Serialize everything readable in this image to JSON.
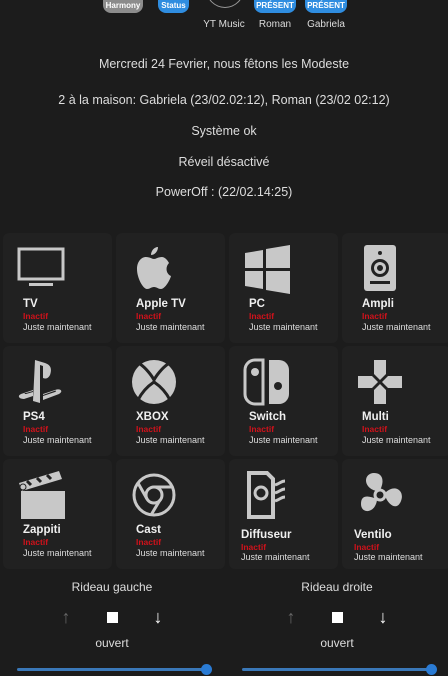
{
  "header": {
    "chips": [
      {
        "label": "Harmony",
        "color": "#8c8c8c"
      },
      {
        "label": "Status",
        "color": "#2f8de0"
      },
      {
        "label": "PRÉSENT",
        "color": "#2f8de0"
      },
      {
        "label": "PRÉSENT",
        "color": "#2f8de0"
      }
    ],
    "labels": [
      "YT Music",
      "Roman",
      "Gabriela"
    ]
  },
  "info": [
    "Mercredi 24 Fevrier, nous fêtons les Modeste",
    "2 à la maison: Gabriela (23/02.02:12), Roman (23/02 02:12)",
    "Système ok",
    "Réveil désactivé",
    "PowerOff : (22/02.14:25)"
  ],
  "devices": [
    {
      "name": "TV",
      "state": "Inactif",
      "time": "Juste maintenant",
      "icon": "tv-icon"
    },
    {
      "name": "Apple TV",
      "state": "Inactif",
      "time": "Juste maintenant",
      "icon": "apple-icon"
    },
    {
      "name": "PC",
      "state": "Inactif",
      "time": "Juste maintenant",
      "icon": "windows-icon"
    },
    {
      "name": "Ampli",
      "state": "Inactif",
      "time": "Juste maintenant",
      "icon": "speaker-icon"
    },
    {
      "name": "PS4",
      "state": "Inactif",
      "time": "Juste maintenant",
      "icon": "playstation-icon"
    },
    {
      "name": "XBOX",
      "state": "Inactif",
      "time": "Juste maintenant",
      "icon": "xbox-icon"
    },
    {
      "name": "Switch",
      "state": "Inactif",
      "time": "Juste maintenant",
      "icon": "switch-icon"
    },
    {
      "name": "Multi",
      "state": "Inactif",
      "time": "Juste maintenant",
      "icon": "gamepad-icon"
    },
    {
      "name": "Zappiti",
      "state": "Inactif",
      "time": "Juste maintenant",
      "icon": "clapperboard-icon"
    },
    {
      "name": "Cast",
      "state": "Inactif",
      "time": "Juste maintenant",
      "icon": "chrome-icon"
    },
    {
      "name": "Diffuseur",
      "state": "Inactif",
      "time": "Juste maintenant",
      "icon": "diffuser-icon"
    },
    {
      "name": "Ventilo",
      "state": "Inactif",
      "time": "Juste maintenant",
      "icon": "fan-icon"
    }
  ],
  "curtains": [
    {
      "title": "Rideau gauche",
      "state": "ouvert",
      "position": 100
    },
    {
      "title": "Rideau droite",
      "state": "ouvert",
      "position": 100
    }
  ]
}
